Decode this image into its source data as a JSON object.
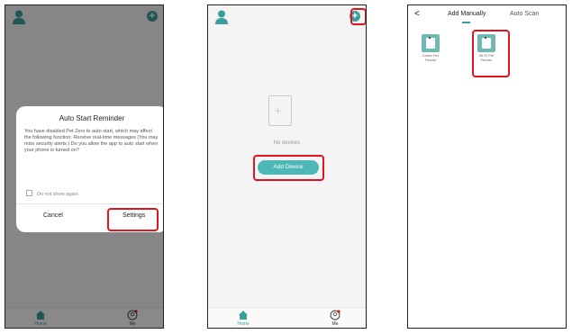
{
  "colors": {
    "accent": "#3a9e9c",
    "highlight": "#e0151d"
  },
  "panel1": {
    "dialog": {
      "title": "Auto Start Reminder",
      "body": "You have disabled Pet Zero to auto start, which may affect the following function: Receive real-time messages (You may miss security alerts.) Do you allow the app to auto start when your phone is turned on?",
      "checkbox": "Do not show again.",
      "cancel": "Cancel",
      "settings": "Settings"
    },
    "tabs": {
      "home": "Home",
      "me": "Me"
    }
  },
  "panel2": {
    "empty_text": "No devices",
    "add_device": "Add Device",
    "tabs": {
      "home": "Home",
      "me": "Me"
    }
  },
  "panel3": {
    "back": "<",
    "tab_manual": "Add Manually",
    "tab_scan": "Auto Scan",
    "devices": [
      {
        "label": "Smart Pet Feeder"
      },
      {
        "label": "Wi-Fi Pet Feeder"
      }
    ]
  }
}
